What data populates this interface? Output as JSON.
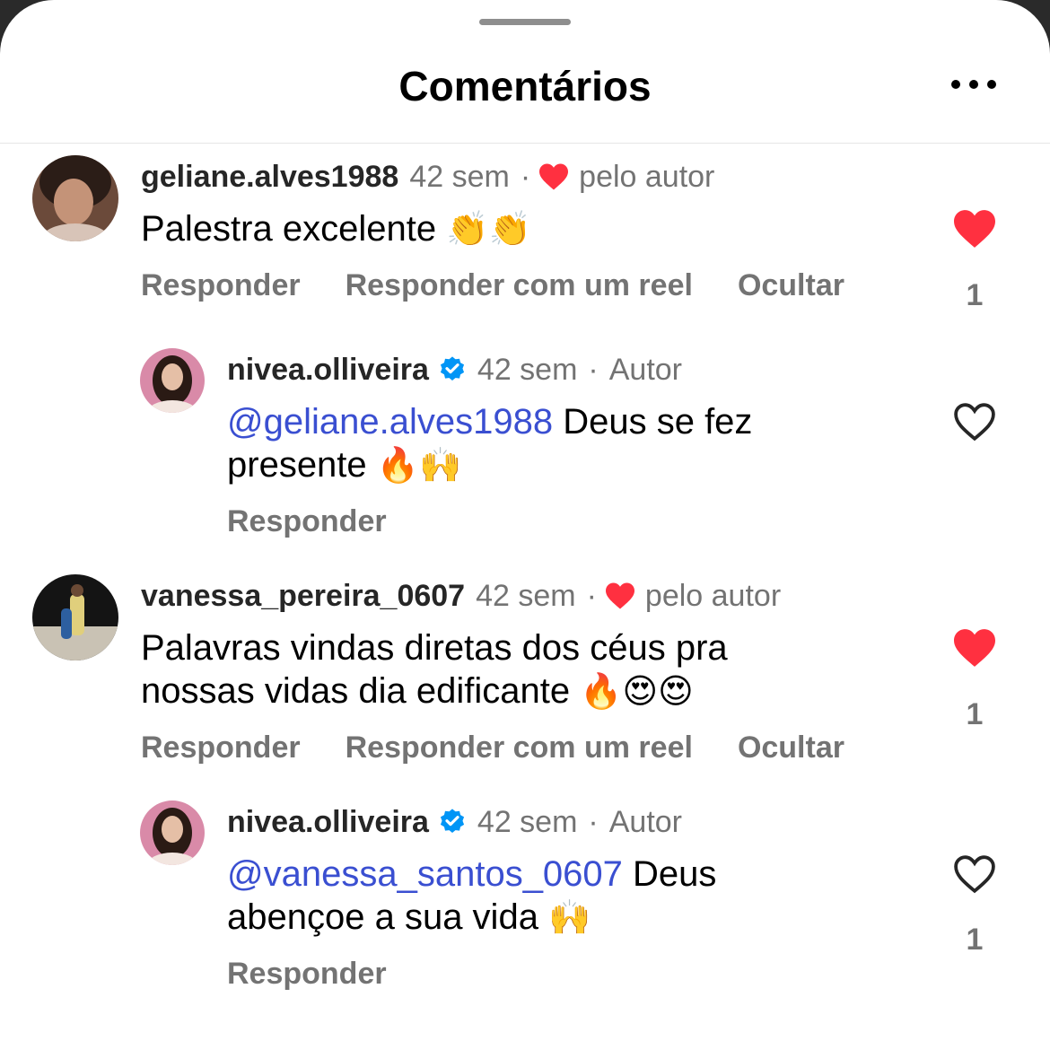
{
  "header": {
    "title": "Comentários"
  },
  "comments": [
    {
      "username": "geliane.alves1988",
      "time": "42 sem",
      "dot": "·",
      "liked_by_author": "pelo autor",
      "text": "Palestra excelente",
      "emoji": "👏👏",
      "actions": {
        "reply": "Responder",
        "reply_reel": "Responder com um reel",
        "hide": "Ocultar"
      },
      "likes": "1",
      "liked": true
    },
    {
      "username": "nivea.olliveira",
      "time": "42 sem",
      "dot": "·",
      "author_label": "Autor",
      "mention": "@geliane.alves1988",
      "text_line1": "Deus se fez",
      "text_line2": "presente",
      "emoji": "🔥🙌",
      "actions": {
        "reply": "Responder"
      },
      "liked": false
    },
    {
      "username": "vanessa_pereira_0607",
      "time": "42 sem",
      "dot": "·",
      "liked_by_author": "pelo autor",
      "text_line1": "Palavras vindas diretas dos céus pra",
      "text_line2": "nossas vidas dia edificante",
      "emoji": "🔥😍😍",
      "actions": {
        "reply": "Responder",
        "reply_reel": "Responder com um reel",
        "hide": "Ocultar"
      },
      "likes": "1",
      "liked": true
    },
    {
      "username": "nivea.olliveira",
      "time": "42 sem",
      "dot": "·",
      "author_label": "Autor",
      "mention": "@vanessa_santos_0607",
      "text_line1": "Deus",
      "text_line2": "abençoe a sua vida",
      "emoji": "🙌",
      "actions": {
        "reply": "Responder"
      },
      "likes": "1",
      "liked": false
    }
  ],
  "colors": {
    "like_red": "#ff3040",
    "mention_blue": "#3a4fd1",
    "verified_blue": "#0095f6",
    "secondary_gray": "#737373"
  }
}
